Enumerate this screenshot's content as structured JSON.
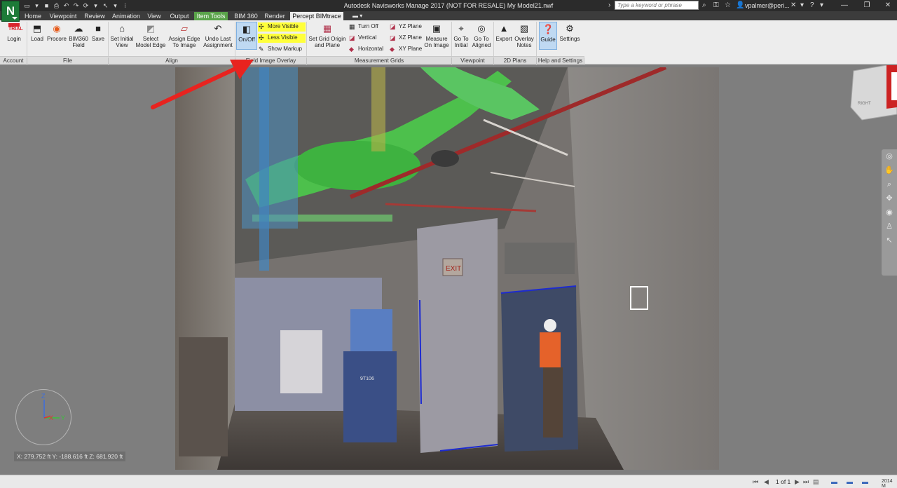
{
  "app": {
    "logo_letter": "N",
    "title": "Autodesk Navisworks Manage 2017 (NOT FOR RESALE)    My Model21.nwf",
    "search_placeholder": "Type a keyword or phrase",
    "user": "vpalmer@peri...",
    "window_controls": [
      "minimize",
      "restore",
      "close"
    ]
  },
  "tabs": [
    {
      "label": "Home"
    },
    {
      "label": "Viewpoint"
    },
    {
      "label": "Review"
    },
    {
      "label": "Animation"
    },
    {
      "label": "View"
    },
    {
      "label": "Output"
    },
    {
      "label": "Item Tools"
    },
    {
      "label": "BIM 360"
    },
    {
      "label": "Render"
    },
    {
      "label": "Percept BIMtrace"
    }
  ],
  "ribbon": {
    "account": {
      "panel": "Account",
      "login": "Login",
      "trial_badge": "TRIAL"
    },
    "file": {
      "panel": "File",
      "load": "Load",
      "procore": "Procore",
      "bim360_field": "BIM360 Field",
      "save": "Save"
    },
    "align": {
      "panel": "Align",
      "set_initial_view": "Set Initial View",
      "select_model_edge": "Select Model Edge",
      "assign_edge": "Assign Edge To Image",
      "undo_last": "Undo Last Assignment"
    },
    "overlay": {
      "panel": "Field Image Overlay",
      "on_off": "On/Off",
      "more_visible": "More Visible",
      "less_visible": "Less Visible",
      "show_markup": "Show Markup"
    },
    "grids": {
      "panel": "Measurement Grids",
      "set_grid_origin": "Set Grid Origin and Plane",
      "turn_off": "Turn Off",
      "vertical": "Vertical",
      "horizontal": "Horizontal",
      "yz_plane": "YZ Plane",
      "xz_plane": "XZ Plane",
      "xy_plane": "XY Plane",
      "measure_on_image": "Measure On Image"
    },
    "viewpoint": {
      "panel": "Viewpoint",
      "go_to_initial": "Go To Initial",
      "go_to_aligned": "Go To Aligned"
    },
    "plans": {
      "panel": "2D Plans",
      "export": "Export",
      "overlay_notes": "Overlay Notes"
    },
    "help": {
      "panel": "Help and Settings",
      "guide": "Guide",
      "settings": "Settings"
    }
  },
  "viewport": {
    "exit_sign": "EXIT",
    "lift_label": "9T106",
    "coord_readout": "X: 279.752 ft  Y: -188.616 ft  Z: 681.920 ft",
    "viewcube_face": "RIGHT",
    "axis_labels": {
      "z": "Z",
      "x": "X",
      "y": "Y"
    },
    "nav_tools": [
      "steering-wheel-icon",
      "pan-icon",
      "zoom-icon",
      "orbit-icon",
      "look-icon",
      "walk-icon",
      "select-icon"
    ]
  },
  "status": {
    "page": "1 of 1",
    "memory": "2014 M"
  },
  "colors": {
    "titlebar": "#2b2b2b",
    "tab_context": "#5aa34a",
    "highlight": "#ffff3a",
    "annotation_arrow": "#e8231f",
    "model_green": "#4bd24b"
  }
}
